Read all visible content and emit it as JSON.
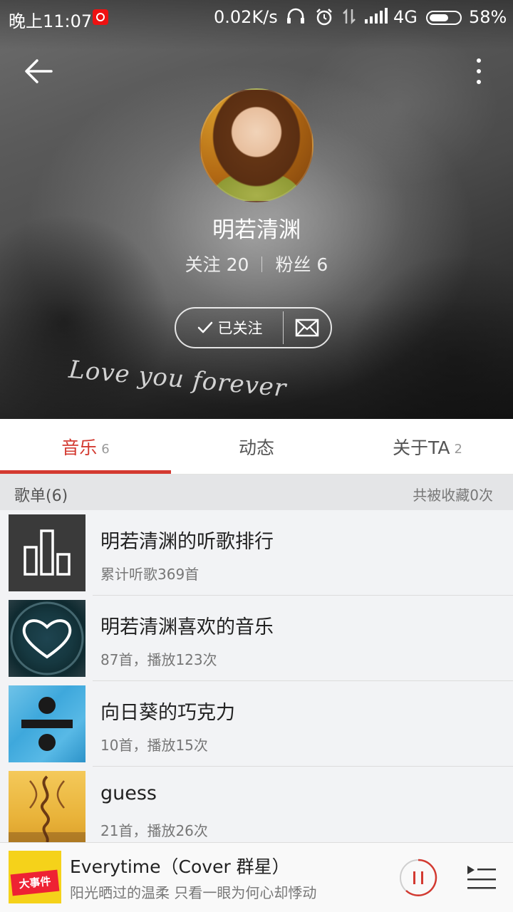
{
  "status_bar": {
    "time": "晚上11:07",
    "speed": "0.02K/s",
    "network": "4G",
    "battery": "58%",
    "icons": [
      "netease-music-icon",
      "headphones-icon",
      "alarm-icon",
      "data-arrows-icon",
      "signal-icon",
      "battery-icon"
    ]
  },
  "banner": {
    "script_text": "Love you forever"
  },
  "profile": {
    "name": "明若清渊",
    "following_label": "关注",
    "following_count": "20",
    "followers_label": "粉丝",
    "followers_count": "6",
    "follow_button": "已关注"
  },
  "tabs": [
    {
      "label": "音乐",
      "count": "6",
      "active": true
    },
    {
      "label": "动态",
      "count": "",
      "active": false
    },
    {
      "label": "关于TA",
      "count": "2",
      "active": false
    }
  ],
  "section": {
    "title": "歌单(6)",
    "meta": "共被收藏0次"
  },
  "playlists": [
    {
      "title": "明若清渊的听歌排行",
      "sub": "累计听歌369首",
      "cover": "ranking-bars-icon"
    },
    {
      "title": "明若清渊喜欢的音乐",
      "sub": "87首，播放123次",
      "cover": "heart-icon"
    },
    {
      "title": "向日葵的巧克力",
      "sub": "10首，播放15次",
      "cover": "divide-album-art"
    },
    {
      "title": "guess",
      "sub": "21首，播放26次",
      "cover": "molly-album-art"
    }
  ],
  "player": {
    "title": "Everytime（Cover 群星）",
    "subtitle": "阳光晒过的温柔 只看一眼为何心却悸动",
    "cover_text": "大事件",
    "accent": "#d33a31"
  },
  "colors": {
    "accent": "#d33a31",
    "background": "#f2f3f5"
  }
}
